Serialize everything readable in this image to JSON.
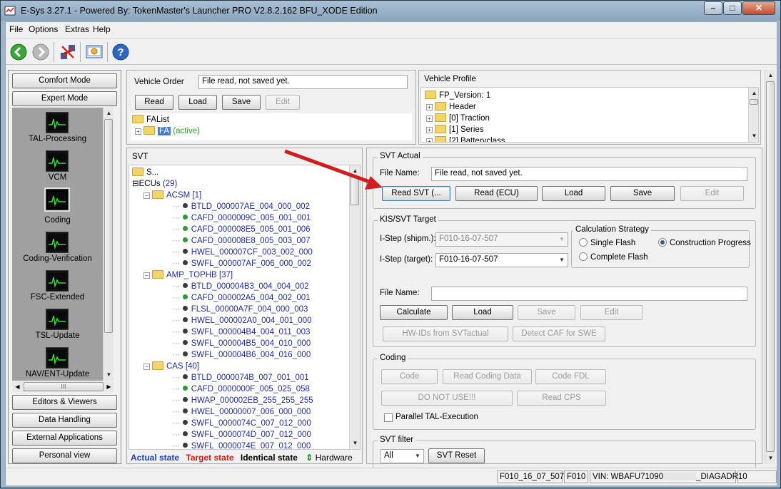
{
  "window": {
    "title": "E-Sys 3.27.1 - Powered By: TokenMaster's Launcher PRO V2.8.2.162 BFU_XODE Edition",
    "minimize": "–",
    "maximize": "□",
    "close": "✕"
  },
  "menu": [
    "File",
    "Options",
    "Extras",
    "Help"
  ],
  "toolbar": {
    "icons": [
      "back-icon",
      "forward-icon",
      "connect-icon",
      "settings-icon",
      "help-icon"
    ],
    "help_glyph": "?"
  },
  "nav": {
    "comfort_mode": "Comfort Mode",
    "expert_mode": "Expert Mode",
    "items": [
      {
        "label": "TAL-Processing"
      },
      {
        "label": "VCM"
      },
      {
        "label": "Coding"
      },
      {
        "label": "Coding-Verification"
      },
      {
        "label": "FSC-Extended"
      },
      {
        "label": "TSL-Update"
      },
      {
        "label": "NAV/ENT-Update"
      }
    ],
    "scroll_glyph": "III",
    "editors": "Editors & Viewers",
    "data_handling": "Data Handling",
    "external_apps": "External Applications",
    "personal_view": "Personal view"
  },
  "vehicle_order": {
    "label": "Vehicle Order",
    "file_value": "File read, not saved yet.",
    "read": "Read",
    "load": "Load",
    "save": "Save",
    "edit": "Edit",
    "tree_root": "FAList",
    "tree_child": "FA",
    "tree_child_status": "(active)"
  },
  "vehicle_profile": {
    "label": "Vehicle Profile",
    "items": [
      "FP_Version: 1",
      "Header",
      "[0] Traction",
      "[1] Series",
      "[2] Batteryclass"
    ]
  },
  "svt": {
    "label": "SVT",
    "root": "S...",
    "ecus_label": "ECUs",
    "ecus_count": "(29)",
    "groups": [
      {
        "name": "ACSM",
        "count": "[1]",
        "items": [
          {
            "id": "BTLD_000007AE_004_000_002",
            "kind": "dark"
          },
          {
            "id": "CAFD_0000009C_005_001_001",
            "kind": "green"
          },
          {
            "id": "CAFD_000008E5_005_001_006",
            "kind": "green"
          },
          {
            "id": "CAFD_000008E8_005_003_007",
            "kind": "green"
          },
          {
            "id": "HWEL_000007CF_003_002_000",
            "kind": "dark"
          },
          {
            "id": "SWFL_000007AF_006_000_002",
            "kind": "dark"
          }
        ]
      },
      {
        "name": "AMP_TOPHB",
        "count": "[37]",
        "items": [
          {
            "id": "BTLD_000004B3_004_004_002",
            "kind": "dark"
          },
          {
            "id": "CAFD_000002A5_004_002_001",
            "kind": "green"
          },
          {
            "id": "FLSL_00000A7F_004_000_003",
            "kind": "dark"
          },
          {
            "id": "HWEL_000002A0_004_001_000",
            "kind": "dark"
          },
          {
            "id": "SWFL_000004B4_004_011_003",
            "kind": "dark"
          },
          {
            "id": "SWFL_000004B5_004_010_000",
            "kind": "dark"
          },
          {
            "id": "SWFL_000004B6_004_016_000",
            "kind": "dark"
          }
        ]
      },
      {
        "name": "CAS",
        "count": "[40]",
        "items": [
          {
            "id": "BTLD_0000074B_007_001_001",
            "kind": "dark"
          },
          {
            "id": "CAFD_0000000F_005_025_058",
            "kind": "green"
          },
          {
            "id": "HWAP_000002EB_255_255_255",
            "kind": "dark"
          },
          {
            "id": "HWEL_00000007_006_000_000",
            "kind": "dark"
          },
          {
            "id": "SWFL_0000074C_007_012_000",
            "kind": "dark"
          },
          {
            "id": "SWFL_0000074D_007_012_000",
            "kind": "dark"
          },
          {
            "id": "SWFL_0000074E_007_012_000",
            "kind": "dark"
          }
        ]
      }
    ],
    "legend": {
      "actual": "Actual state",
      "target": "Target state",
      "identical": "Identical state",
      "hardware": "Hardware",
      "actual_color": "#1a3fa8",
      "target_color": "#c21f1f",
      "identical_color": "#000000",
      "hardware_color": "#1f8a2a"
    }
  },
  "svt_actual": {
    "label": "SVT Actual",
    "file_name_label": "File Name:",
    "file_name_value": "File read, not saved yet.",
    "read_svt": "Read SVT (...",
    "read_ecu": "Read (ECU)",
    "load": "Load",
    "save": "Save",
    "edit": "Edit"
  },
  "kis_target": {
    "label": "KIS/SVT Target",
    "istep_shipm_label": "I-Step (shipm.):",
    "istep_shipm_value": "F010-16-07-507",
    "istep_target_label": "I-Step (target):",
    "istep_target_value": "F010-16-07-507",
    "calc_strategy_label": "Calculation Strategy",
    "single_flash": "Single Flash",
    "construction_progress": "Construction Progress",
    "complete_flash": "Complete Flash",
    "file_name_label": "File Name:",
    "file_name_value": "",
    "calculate": "Calculate",
    "load": "Load",
    "save": "Save",
    "edit": "Edit",
    "hw_ids": "HW-IDs from SVTactual",
    "detect_caf": "Detect CAF for SWE"
  },
  "coding": {
    "label": "Coding",
    "code": "Code",
    "read_coding_data": "Read Coding Data",
    "code_fdl": "Code FDL",
    "do_not_use": "DO NOT USE!!!",
    "read_cps": "Read CPS",
    "parallel": "Parallel TAL-Execution"
  },
  "svt_filter": {
    "label": "SVT filter",
    "select_value": "All",
    "reset": "SVT Reset"
  },
  "status": {
    "istep": "F010_16_07_507",
    "series": "F010",
    "vin_prefix": "VIN: WBAFU71090",
    "vin_suffix": "_DIAGADR10"
  }
}
